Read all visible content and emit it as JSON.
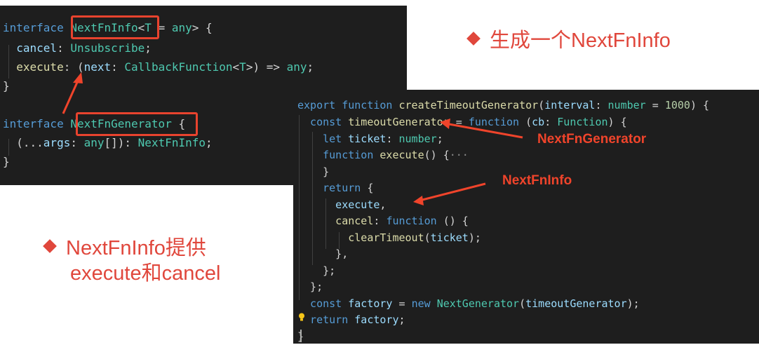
{
  "panel1": {
    "lines": [
      [
        "interface ",
        "NextFnInfo",
        "<",
        "T",
        " = ",
        "any",
        "> {"
      ],
      [
        "  cancel",
        ": ",
        "Unsubscribe",
        ";"
      ],
      [
        "  execute",
        ": (",
        "next",
        ": ",
        "CallbackFunction",
        "<",
        "T",
        ">) => ",
        "any",
        ";"
      ],
      [
        "}"
      ],
      [
        ""
      ],
      [
        "interface ",
        "NextFnGenerator",
        " {"
      ],
      [
        "  (...",
        "args",
        ": ",
        "any",
        "[]): ",
        "NextFnInfo",
        ";"
      ],
      [
        "}"
      ]
    ]
  },
  "panel2": {
    "lines": [
      [
        "export ",
        "function ",
        "createTimeoutGenerator",
        "(",
        "interval",
        ": ",
        "number",
        " = ",
        "1000",
        ") {"
      ],
      [
        "  const ",
        "timeoutGenerator",
        " = ",
        "function ",
        "(",
        "cb",
        ": ",
        "Function",
        ") {"
      ],
      [
        "    let ",
        "ticket",
        ": ",
        "number",
        ";"
      ],
      [
        "    function ",
        "execute",
        "() {",
        "···"
      ],
      [
        "    }"
      ],
      [
        "    return ",
        "{"
      ],
      [
        "      execute",
        ","
      ],
      [
        "      cancel",
        ": ",
        "function ",
        "() {"
      ],
      [
        "        clearTimeout",
        "(",
        "ticket",
        ");"
      ],
      [
        "      },"
      ],
      [
        "    };"
      ],
      [
        "  };"
      ],
      [
        "  const ",
        "factory",
        " = ",
        "new ",
        "NextGenerator",
        "(",
        "timeoutGenerator",
        ");"
      ],
      [
        "  return ",
        "factory",
        ";"
      ],
      [
        "}"
      ]
    ]
  },
  "annotations": {
    "next_fn_generator": "NextFnGenerator",
    "next_fn_info": "NextFnInfo"
  },
  "bullets": {
    "top_right": "生成一个NextFnInfo",
    "left_line1": "NextFnInfo提供",
    "left_line2": "execute和cancel"
  },
  "colors": {
    "editor_bg": "#1e1e1e",
    "keyword": "#569cd6",
    "type": "#4ec9b0",
    "function": "#dcdcaa",
    "param": "#9cdcfe",
    "number": "#b5cea8",
    "annotation_red": "#f0442b",
    "bullet_red": "#e0473c"
  }
}
